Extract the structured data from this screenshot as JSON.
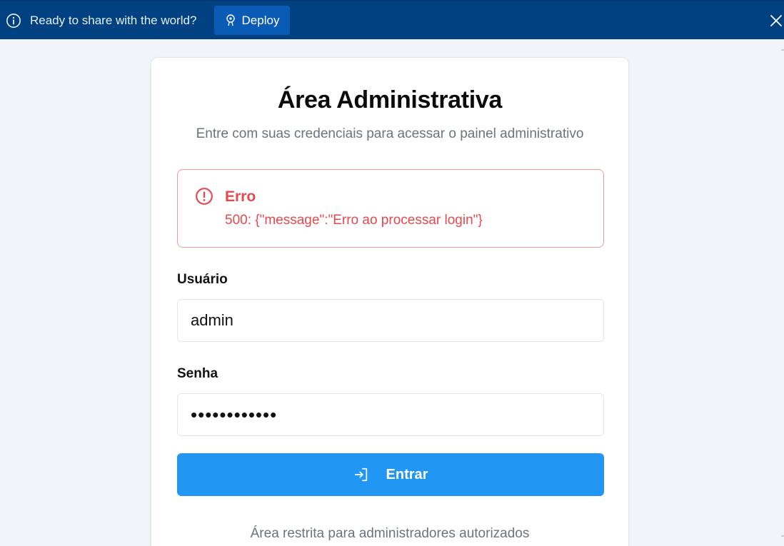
{
  "banner": {
    "message": "Ready to share with the world?",
    "deploy_label": "Deploy",
    "background": "#004182"
  },
  "login": {
    "title": "Área Administrativa",
    "subtitle": "Entre com suas credenciais para acessar o painel administrativo",
    "error": {
      "title": "Erro",
      "message": "500: {\"message\":\"Erro ao processar login\"}",
      "color": "#e5484d"
    },
    "username": {
      "label": "Usuário",
      "value": "admin"
    },
    "password": {
      "label": "Senha",
      "value": "••••••••••••"
    },
    "submit_label": "Entrar",
    "accent": "#2196f3",
    "footer": "Área restrita para administradores autorizados"
  },
  "icons": {
    "banner_info": "info-circle-icon",
    "deploy": "deploy-icon",
    "close": "close-icon",
    "error": "alert-circle-icon",
    "submit": "login-icon"
  }
}
